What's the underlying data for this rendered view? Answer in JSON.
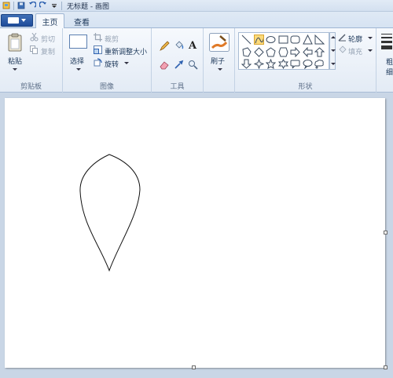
{
  "titlebar": {
    "title": "无标题 - 画图",
    "icons": [
      "paint-app-icon",
      "save-icon",
      "undo-icon",
      "redo-icon",
      "customize-quick-access-icon"
    ]
  },
  "tabs": [
    {
      "label": "主页",
      "active": true
    },
    {
      "label": "查看",
      "active": false
    }
  ],
  "ribbon": {
    "clipboard": {
      "paste_label": "粘贴",
      "cut_label": "剪切",
      "copy_label": "复制",
      "group_label": "剪贴板"
    },
    "image": {
      "select_label": "选择",
      "crop_label": "裁剪",
      "resize_label": "重新调整大小",
      "rotate_label": "旋转",
      "group_label": "图像"
    },
    "tools": {
      "items": [
        "pencil-icon",
        "fill-icon",
        "text-icon",
        "eraser-icon",
        "color-picker-icon",
        "magnifier-icon"
      ],
      "text_glyph": "A",
      "group_label": "工具"
    },
    "brushes": {
      "label": "刷子"
    },
    "shapes": {
      "group_label": "形状",
      "outline_label": "轮廓",
      "fill_label": "填充",
      "selected": "curve"
    },
    "size": {
      "label_top": "粗",
      "label_bottom": "细"
    }
  },
  "colors": {
    "accent": "#2a5aa8",
    "selected_shape": "#fbd979",
    "workspace": "#c9d6e6",
    "canvas": "#ffffff"
  }
}
